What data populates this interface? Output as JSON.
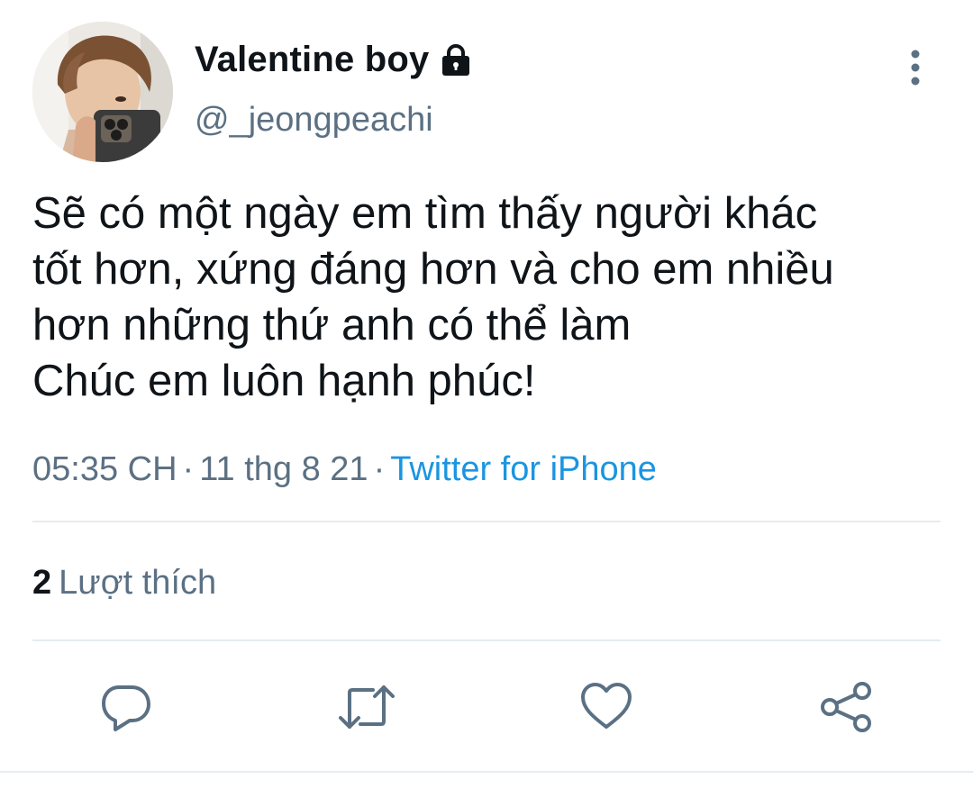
{
  "user": {
    "display_name": "Valentine boy",
    "handle": "@_jeongpeachi",
    "protected_icon": "lock-icon",
    "avatar": "profile-photo"
  },
  "tweet": {
    "lines": [
      "Sẽ có một ngày em tìm thấy người khác",
      "tốt hơn, xứng đáng hơn và cho em nhiều",
      "hơn những thứ anh có thể làm",
      "Chúc em luôn hạnh phúc!"
    ],
    "time": "05:35 CH",
    "separator": "·",
    "date": "11 thg 8 21",
    "source": "Twitter for iPhone"
  },
  "stats": {
    "likes_count": "2",
    "likes_label": "Lượt thích"
  },
  "actions": {
    "reply_icon": "reply-icon",
    "retweet_icon": "retweet-icon",
    "like_icon": "heart-icon",
    "share_icon": "share-icon",
    "more_icon": "more-vertical-icon"
  },
  "colors": {
    "text": "#0f1419",
    "secondary": "#5b7083",
    "link": "#1b95e0",
    "divider": "#e6ecf0",
    "icon": "#5b7083"
  }
}
